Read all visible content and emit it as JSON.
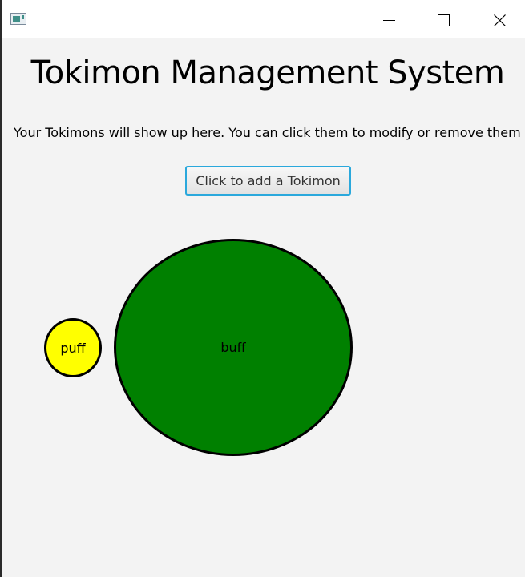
{
  "window": {
    "controls": {
      "minimize": "minimize-icon",
      "maximize": "maximize-icon",
      "close": "close-icon"
    }
  },
  "main": {
    "heading": "Tokimon Management System",
    "instructions": "Your Tokimons will show up here. You can click them to modify or remove them",
    "add_button_label": "Click to add a Tokimon"
  },
  "tokimons": [
    {
      "name": "puff",
      "color": "#ffff00"
    },
    {
      "name": "buff",
      "color": "#008000"
    }
  ]
}
